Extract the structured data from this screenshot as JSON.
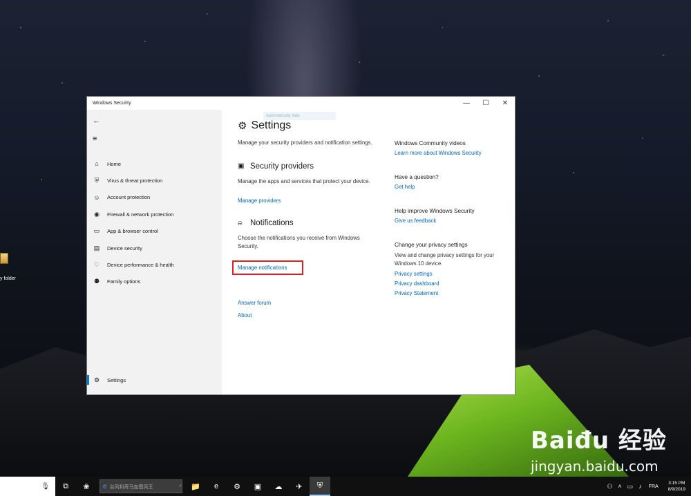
{
  "desktop": {
    "icon_label": "y folder",
    "watermark": {
      "logo": "Baiđu 经验",
      "url": "jingyan.baidu.com"
    }
  },
  "window": {
    "title": "Windows Security",
    "controls": {
      "minimize": "—",
      "maximize": "☐",
      "close": "✕"
    }
  },
  "sidebar": {
    "back": "←",
    "menu": "≡",
    "items": [
      {
        "label": "Home",
        "icon": "home-icon",
        "glyph": "⌂"
      },
      {
        "label": "Virus & threat protection",
        "icon": "shield-icon",
        "glyph": "⛨"
      },
      {
        "label": "Account protection",
        "icon": "person-icon",
        "glyph": "☺"
      },
      {
        "label": "Firewall & network protection",
        "icon": "wifi-icon",
        "glyph": "◉"
      },
      {
        "label": "App & browser control",
        "icon": "app-window-icon",
        "glyph": "▭"
      },
      {
        "label": "Device security",
        "icon": "laptop-icon",
        "glyph": "▤"
      },
      {
        "label": "Device performance & health",
        "icon": "heart-icon",
        "glyph": "♡"
      },
      {
        "label": "Family options",
        "icon": "family-icon",
        "glyph": "⚉"
      }
    ],
    "settings": {
      "label": "Settings",
      "glyph": "⚙"
    }
  },
  "main": {
    "ghost_text": "Automatically hide",
    "title": "Settings",
    "title_glyph": "⚙",
    "description": "Manage your security providers and notification settings.",
    "security_providers": {
      "title": "Security providers",
      "glyph": "▣",
      "description": "Manage the apps and services that protect your device.",
      "link": "Manage providers"
    },
    "notifications": {
      "title": "Notifications",
      "glyph": "⍾",
      "description": "Choose the notifications you receive from Windows Security.",
      "link": "Manage notifications"
    },
    "answer_forum": "Answer forum",
    "about": "About"
  },
  "right": {
    "community": {
      "heading": "Windows Community videos",
      "link": "Learn more about Windows Security"
    },
    "question": {
      "heading": "Have a question?",
      "link": "Get help"
    },
    "improve": {
      "heading": "Help improve Windows Security",
      "link": "Give us feedback"
    },
    "privacy": {
      "heading": "Change your privacy settings",
      "description": "View and change privacy settings for your Windows 10 device.",
      "links": [
        "Privacy settings",
        "Privacy dashboard",
        "Privacy Statement"
      ]
    }
  },
  "taskbar": {
    "mic": "🎙",
    "taskview": "⧉",
    "search_placeholder": "台风利奇马加图风王",
    "search_glyph": "⌕",
    "apps": [
      "❀",
      "📁",
      "e",
      "⚙",
      "▣",
      "☁",
      "✈",
      "⛨"
    ],
    "tray": {
      "people": "⚇",
      "chevron": "˄",
      "lang": "FRA",
      "time": "3:15 PM",
      "date": "8/9/2019"
    }
  },
  "colors": {
    "accent": "#0067b8",
    "highlight_box": "#e02020",
    "sidebar_bg": "#f2f2f2"
  }
}
